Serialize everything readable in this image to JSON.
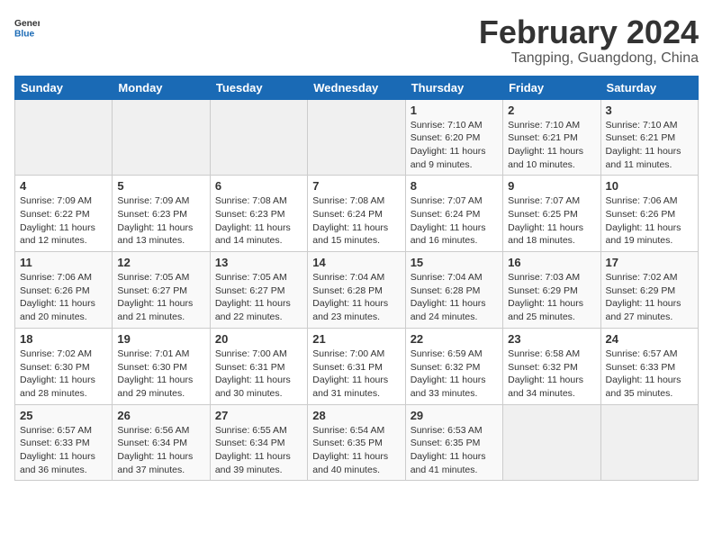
{
  "header": {
    "logo_general": "General",
    "logo_blue": "Blue",
    "main_title": "February 2024",
    "subtitle": "Tangping, Guangdong, China"
  },
  "calendar": {
    "weekdays": [
      "Sunday",
      "Monday",
      "Tuesday",
      "Wednesday",
      "Thursday",
      "Friday",
      "Saturday"
    ],
    "weeks": [
      [
        {
          "day": "",
          "info": ""
        },
        {
          "day": "",
          "info": ""
        },
        {
          "day": "",
          "info": ""
        },
        {
          "day": "",
          "info": ""
        },
        {
          "day": "1",
          "info": "Sunrise: 7:10 AM\nSunset: 6:20 PM\nDaylight: 11 hours\nand 9 minutes."
        },
        {
          "day": "2",
          "info": "Sunrise: 7:10 AM\nSunset: 6:21 PM\nDaylight: 11 hours\nand 10 minutes."
        },
        {
          "day": "3",
          "info": "Sunrise: 7:10 AM\nSunset: 6:21 PM\nDaylight: 11 hours\nand 11 minutes."
        }
      ],
      [
        {
          "day": "4",
          "info": "Sunrise: 7:09 AM\nSunset: 6:22 PM\nDaylight: 11 hours\nand 12 minutes."
        },
        {
          "day": "5",
          "info": "Sunrise: 7:09 AM\nSunset: 6:23 PM\nDaylight: 11 hours\nand 13 minutes."
        },
        {
          "day": "6",
          "info": "Sunrise: 7:08 AM\nSunset: 6:23 PM\nDaylight: 11 hours\nand 14 minutes."
        },
        {
          "day": "7",
          "info": "Sunrise: 7:08 AM\nSunset: 6:24 PM\nDaylight: 11 hours\nand 15 minutes."
        },
        {
          "day": "8",
          "info": "Sunrise: 7:07 AM\nSunset: 6:24 PM\nDaylight: 11 hours\nand 16 minutes."
        },
        {
          "day": "9",
          "info": "Sunrise: 7:07 AM\nSunset: 6:25 PM\nDaylight: 11 hours\nand 18 minutes."
        },
        {
          "day": "10",
          "info": "Sunrise: 7:06 AM\nSunset: 6:26 PM\nDaylight: 11 hours\nand 19 minutes."
        }
      ],
      [
        {
          "day": "11",
          "info": "Sunrise: 7:06 AM\nSunset: 6:26 PM\nDaylight: 11 hours\nand 20 minutes."
        },
        {
          "day": "12",
          "info": "Sunrise: 7:05 AM\nSunset: 6:27 PM\nDaylight: 11 hours\nand 21 minutes."
        },
        {
          "day": "13",
          "info": "Sunrise: 7:05 AM\nSunset: 6:27 PM\nDaylight: 11 hours\nand 22 minutes."
        },
        {
          "day": "14",
          "info": "Sunrise: 7:04 AM\nSunset: 6:28 PM\nDaylight: 11 hours\nand 23 minutes."
        },
        {
          "day": "15",
          "info": "Sunrise: 7:04 AM\nSunset: 6:28 PM\nDaylight: 11 hours\nand 24 minutes."
        },
        {
          "day": "16",
          "info": "Sunrise: 7:03 AM\nSunset: 6:29 PM\nDaylight: 11 hours\nand 25 minutes."
        },
        {
          "day": "17",
          "info": "Sunrise: 7:02 AM\nSunset: 6:29 PM\nDaylight: 11 hours\nand 27 minutes."
        }
      ],
      [
        {
          "day": "18",
          "info": "Sunrise: 7:02 AM\nSunset: 6:30 PM\nDaylight: 11 hours\nand 28 minutes."
        },
        {
          "day": "19",
          "info": "Sunrise: 7:01 AM\nSunset: 6:30 PM\nDaylight: 11 hours\nand 29 minutes."
        },
        {
          "day": "20",
          "info": "Sunrise: 7:00 AM\nSunset: 6:31 PM\nDaylight: 11 hours\nand 30 minutes."
        },
        {
          "day": "21",
          "info": "Sunrise: 7:00 AM\nSunset: 6:31 PM\nDaylight: 11 hours\nand 31 minutes."
        },
        {
          "day": "22",
          "info": "Sunrise: 6:59 AM\nSunset: 6:32 PM\nDaylight: 11 hours\nand 33 minutes."
        },
        {
          "day": "23",
          "info": "Sunrise: 6:58 AM\nSunset: 6:32 PM\nDaylight: 11 hours\nand 34 minutes."
        },
        {
          "day": "24",
          "info": "Sunrise: 6:57 AM\nSunset: 6:33 PM\nDaylight: 11 hours\nand 35 minutes."
        }
      ],
      [
        {
          "day": "25",
          "info": "Sunrise: 6:57 AM\nSunset: 6:33 PM\nDaylight: 11 hours\nand 36 minutes."
        },
        {
          "day": "26",
          "info": "Sunrise: 6:56 AM\nSunset: 6:34 PM\nDaylight: 11 hours\nand 37 minutes."
        },
        {
          "day": "27",
          "info": "Sunrise: 6:55 AM\nSunset: 6:34 PM\nDaylight: 11 hours\nand 39 minutes."
        },
        {
          "day": "28",
          "info": "Sunrise: 6:54 AM\nSunset: 6:35 PM\nDaylight: 11 hours\nand 40 minutes."
        },
        {
          "day": "29",
          "info": "Sunrise: 6:53 AM\nSunset: 6:35 PM\nDaylight: 11 hours\nand 41 minutes."
        },
        {
          "day": "",
          "info": ""
        },
        {
          "day": "",
          "info": ""
        }
      ]
    ]
  }
}
